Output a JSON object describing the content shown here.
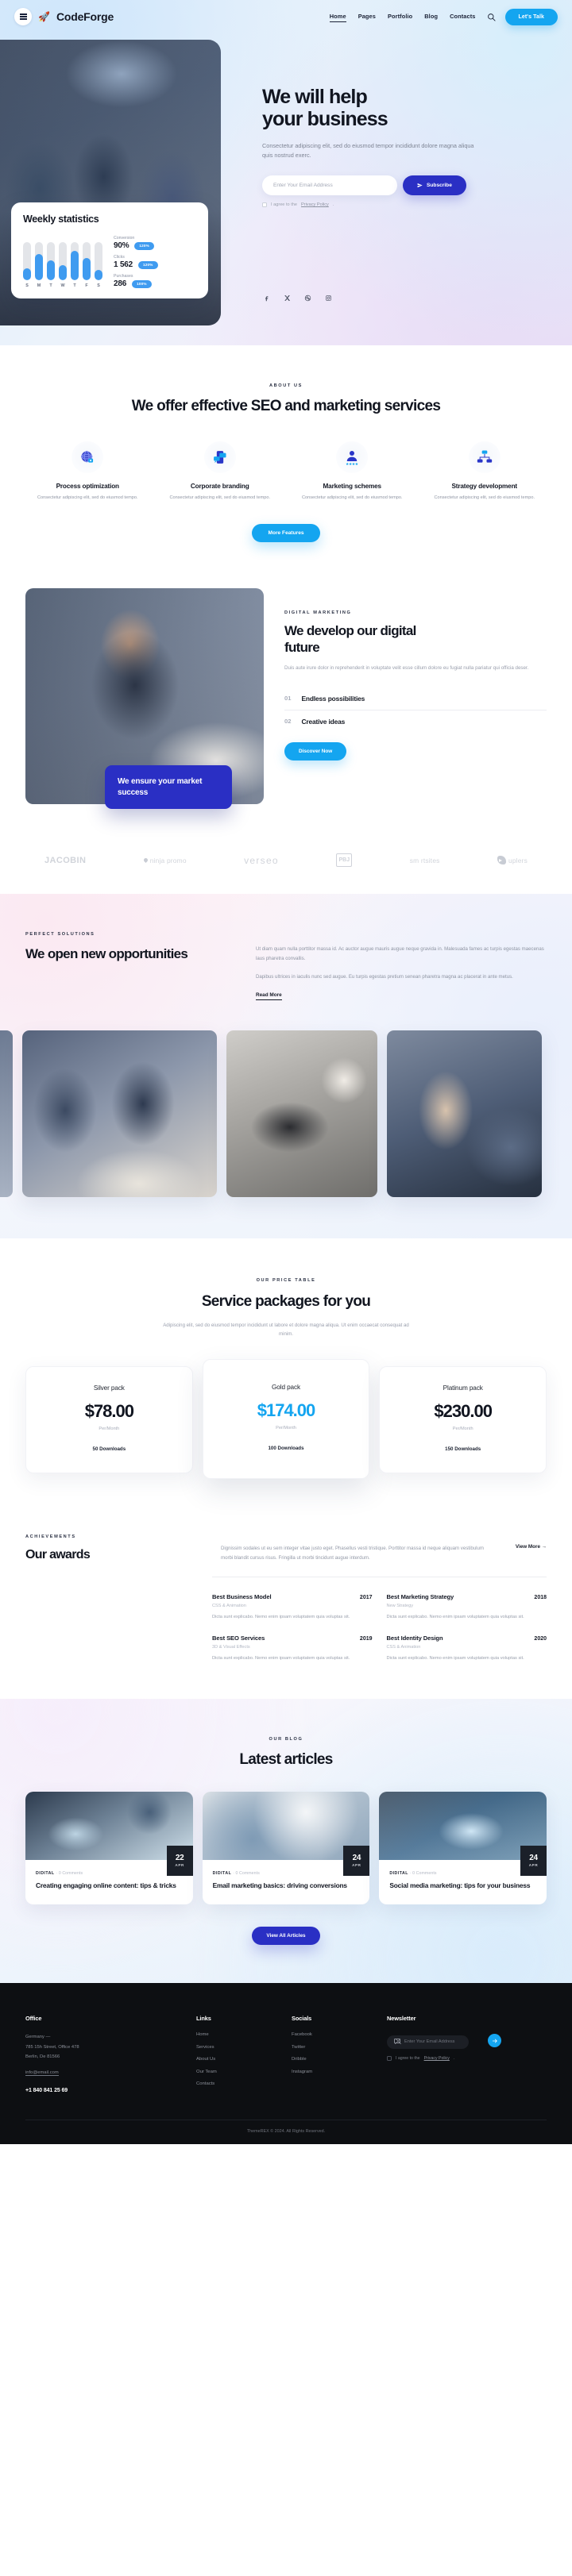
{
  "nav": {
    "brand": "CodeForge",
    "rocket_icon": "rocket-icon",
    "links": [
      "Home",
      "Pages",
      "Portfolio",
      "Blog",
      "Contacts"
    ],
    "cta": "Let's Talk"
  },
  "hero": {
    "title_line1": "We will help",
    "title_line2": "your business",
    "subtitle": "Consectetur adipiscing elit, sed do eiusmod tempor incididunt dolore magna aliqua quis nostrud exerc.",
    "email_placeholder": "Enter Your Email Address",
    "subscribe": "Subscribe",
    "agree_prefix": "I agree to the ",
    "agree_link": "Privacy Policy",
    "agree_suffix": ".",
    "socials": [
      "facebook-icon",
      "x-icon",
      "dribbble-icon",
      "instagram-icon"
    ]
  },
  "stats": {
    "title": "Weekly statistics",
    "chart_days": [
      "S",
      "M",
      "T",
      "W",
      "T",
      "F",
      "S"
    ],
    "metrics": [
      {
        "label": "Conversion",
        "value": "90%",
        "badge": "120%"
      },
      {
        "label": "Clicks",
        "value": "1 562",
        "badge": "120%"
      },
      {
        "label": "Purchases",
        "value": "286",
        "badge": "100%"
      }
    ]
  },
  "about": {
    "eyebrow": "ABOUT US",
    "title": "We offer effective SEO and marketing services",
    "features": [
      {
        "icon": "globe-lock-icon",
        "title": "Process optimization",
        "desc": "Consectetur adipiscing elit, sed do eiusmod tempo."
      },
      {
        "icon": "mobile-chat-icon",
        "title": "Corporate branding",
        "desc": "Consectetur adipiscing elit, sed do eiusmod tempo."
      },
      {
        "icon": "person-stars-icon",
        "title": "Marketing schemes",
        "desc": "Consectetur adipiscing elit, sed do eiusmod tempo."
      },
      {
        "icon": "network-nodes-icon",
        "title": "Strategy development",
        "desc": "Consectetur adipiscing elit, sed do eiusmod tempo."
      }
    ],
    "cta": "More Features"
  },
  "digital": {
    "eyebrow": "DIGITAL MARKETING",
    "title": "We develop our digital future",
    "paragraph": "Duis aute irure dolor in reprehenderit in voluptate velit esse cillum dolore eu fugiat nulla pariatur qui officia deser.",
    "items": [
      {
        "num": "01",
        "name": "Endless possibilities"
      },
      {
        "num": "02",
        "name": "Creative ideas"
      }
    ],
    "cta": "Discover Now",
    "badge": "We ensure your market success"
  },
  "logos": [
    "JACOBIN",
    "ninja promo",
    "verseo",
    "PBJ",
    "sm rtsites",
    "uplers"
  ],
  "opportunities": {
    "eyebrow": "PERFECT SOLUTIONS",
    "title": "We open new opportunities",
    "p1": "Ut diam quam nulla porttitor massa id. Ac auctor augue mauris augue neque gravida in. Malesuada fames ac turpis egestas maecenas laus pharetra convallis.",
    "p2": "Dapibus ultrices in iaculis nunc sed augue. Eu turpis egestas pretium senean pharetra magna ac placerat in ante metus.",
    "read_more": "Read More"
  },
  "pricing": {
    "eyebrow": "OUR PRICE TABLE",
    "title": "Service packages for you",
    "subtitle": "Adipiscing elit, sed do eiusmod tempor incididunt ut labore et dolore magna aliqua. Ut enim occaecat consequat ad minim.",
    "plans": [
      {
        "name": "Silver pack",
        "price": "$78.00",
        "per": "Per/Month",
        "feature": "50 Downloads",
        "featured": false
      },
      {
        "name": "Gold pack",
        "price": "$174.00",
        "per": "Per/Month",
        "feature": "100 Downloads",
        "featured": true
      },
      {
        "name": "Platinum pack",
        "price": "$230.00",
        "per": "Per/Month",
        "feature": "150 Downloads",
        "featured": false
      }
    ]
  },
  "awards": {
    "eyebrow": "ACHIEVEMENTS",
    "title": "Our awards",
    "paragraph": "Dignissim sodales ut eu sem integer vitae justo eget. Phasellus vesti tristique. Porttitor massa id neque aliquam vestibulum morbi blandit cursus risus. Fringilla ut morbi tincidunt augue interdum.",
    "view_more": "View More  →",
    "items": [
      {
        "name": "Best Business Model",
        "year": "2017",
        "category": "CSS & Animation",
        "desc": "Dicta sunt explicabo. Nemo enim ipsam voluptatem quia voluptas sit."
      },
      {
        "name": "Best Marketing Strategy",
        "year": "2018",
        "category": "New Strategy",
        "desc": "Dicta sunt explicabo. Nemo enim ipsam voluptatem quia voluptas sit."
      },
      {
        "name": "Best SEO Services",
        "year": "2019",
        "category": "3D & Visual Effects",
        "desc": "Dicta sunt explicabo. Nemo enim ipsam voluptatem quia voluptas sit."
      },
      {
        "name": "Best Identity Design",
        "year": "2020",
        "category": "CSS & Animation",
        "desc": "Dicta sunt explicabo. Nemo enim ipsam voluptatem quia voluptas sit."
      }
    ]
  },
  "blog": {
    "eyebrow": "OUR BLOG",
    "title": "Latest articles",
    "posts": [
      {
        "day": "22",
        "month": "APR",
        "category": "DIDITAL",
        "comments": "0 Comments",
        "title": "Creating engaging online content: tips & tricks"
      },
      {
        "day": "24",
        "month": "APR",
        "category": "DIDITAL",
        "comments": "0 Comments",
        "title": "Email marketing basics: driving conversions"
      },
      {
        "day": "24",
        "month": "APR",
        "category": "DIDITAL",
        "comments": "0 Comments",
        "title": "Social media marketing: tips for your business"
      }
    ],
    "cta": "View All Articles"
  },
  "footer": {
    "office": {
      "heading": "Office",
      "line1": "Germany —",
      "line2": "785 15h Street, Office 478",
      "line3": "Berlin, De 81566",
      "email": "info@email.com",
      "phone": "+1 840 841 25 69"
    },
    "links": {
      "heading": "Links",
      "items": [
        "Home",
        "Services",
        "About Us",
        "Our Team",
        "Contacts"
      ]
    },
    "socials": {
      "heading": "Socials",
      "items": [
        "Facebook",
        "Twitter",
        "Dribble",
        "Instagram"
      ]
    },
    "newsletter": {
      "heading": "Newsletter",
      "placeholder": "Enter Your Email Address",
      "go_icon": "arrow-right-icon",
      "agree_prefix": "I agree to the ",
      "agree_link": "Privacy Policy",
      "agree_suffix": "."
    },
    "copyright": "ThemeREX © 2024. All Rights Reserved."
  },
  "chart_data": {
    "type": "bar",
    "title": "Weekly statistics",
    "categories": [
      "S",
      "M",
      "T",
      "W",
      "T",
      "F",
      "S"
    ],
    "values": [
      32,
      68,
      52,
      40,
      78,
      58,
      28
    ],
    "ylim": [
      0,
      100
    ],
    "xlabel": "",
    "ylabel": "",
    "grid": false,
    "bar_color": "#3f9bf0",
    "track_color": "#e3e5e9"
  },
  "colors": {
    "accent_blue": "#14a5f0",
    "accent_indigo": "#2a2fc4",
    "dark": "#0d0f12",
    "text": "#12141d",
    "muted": "#9a9fad"
  }
}
